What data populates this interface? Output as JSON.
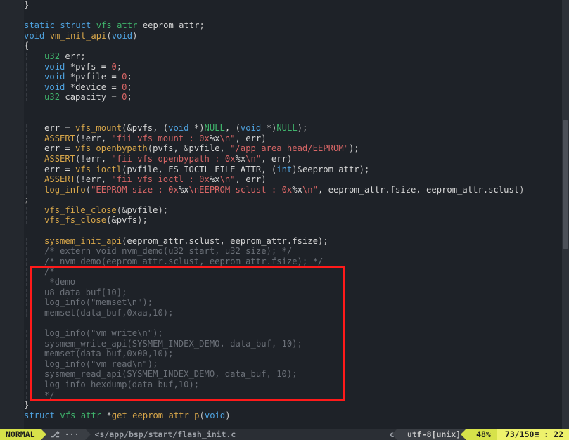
{
  "first_line_no": 95,
  "statusbar": {
    "mode": "NORMAL",
    "branch_icon": "⎇",
    "branch": "···",
    "path": "<s/app/bsp/start/flash_init.c",
    "filetype": "c",
    "encoding": "utf-8[unix]",
    "percent": "48%",
    "position": "73/150≡ : 22"
  },
  "redbox": {
    "top_line": 120,
    "bottom_line": 132,
    "left_col": 4,
    "right_col": 64
  },
  "scrollbar": {
    "top_pct": 28,
    "height_pct": 30
  },
  "lines": [
    {
      "no": 95,
      "indent": 0,
      "spans": [
        [
          "sym",
          "}"
        ]
      ]
    },
    {
      "no": 96,
      "indent": 0,
      "spans": []
    },
    {
      "no": 97,
      "indent": 0,
      "spans": [
        [
          "kw",
          "static"
        ],
        [
          "id",
          " "
        ],
        [
          "kw",
          "struct"
        ],
        [
          "id",
          " "
        ],
        [
          "type",
          "vfs_attr"
        ],
        [
          "id",
          " eeprom_attr"
        ],
        [
          "sym",
          ";"
        ]
      ]
    },
    {
      "no": 98,
      "indent": 0,
      "spans": [
        [
          "kw",
          "void"
        ],
        [
          "id",
          " "
        ],
        [
          "fn",
          "vm_init_api"
        ],
        [
          "sym",
          "("
        ],
        [
          "kw",
          "void"
        ],
        [
          "sym",
          ")"
        ]
      ]
    },
    {
      "no": 99,
      "indent": 0,
      "spans": [
        [
          "sym",
          "{"
        ]
      ]
    },
    {
      "no": 100,
      "indent": 1,
      "spans": [
        [
          "type",
          "u32"
        ],
        [
          "id",
          " err"
        ],
        [
          "sym",
          ";"
        ]
      ]
    },
    {
      "no": 101,
      "indent": 1,
      "spans": [
        [
          "kw",
          "void"
        ],
        [
          "id",
          " "
        ],
        [
          "sym",
          "*"
        ],
        [
          "id",
          "pvfs = "
        ],
        [
          "num",
          "0"
        ],
        [
          "sym",
          ";"
        ]
      ]
    },
    {
      "no": 102,
      "indent": 1,
      "spans": [
        [
          "kw",
          "void"
        ],
        [
          "id",
          " "
        ],
        [
          "sym",
          "*"
        ],
        [
          "id",
          "pvfile = "
        ],
        [
          "num",
          "0"
        ],
        [
          "sym",
          ";"
        ]
      ]
    },
    {
      "no": 103,
      "indent": 1,
      "spans": [
        [
          "kw",
          "void"
        ],
        [
          "id",
          " "
        ],
        [
          "sym",
          "*"
        ],
        [
          "id",
          "device = "
        ],
        [
          "num",
          "0"
        ],
        [
          "sym",
          ";"
        ]
      ]
    },
    {
      "no": 104,
      "indent": 1,
      "spans": [
        [
          "type",
          "u32"
        ],
        [
          "id",
          " capacity = "
        ],
        [
          "num",
          "0"
        ],
        [
          "sym",
          ";"
        ]
      ]
    },
    {
      "no": 105,
      "indent": 0,
      "spans": []
    },
    {
      "no": 106,
      "indent": 0,
      "spans": []
    },
    {
      "no": 107,
      "indent": 1,
      "spans": [
        [
          "id",
          "err = "
        ],
        [
          "fn",
          "vfs_mount"
        ],
        [
          "sym",
          "(&"
        ],
        [
          "id",
          "pvfs, ("
        ],
        [
          "kw",
          "void"
        ],
        [
          "id",
          " "
        ],
        [
          "sym",
          "*)"
        ],
        [
          "type",
          "NULL"
        ],
        [
          "id",
          ", ("
        ],
        [
          "kw",
          "void"
        ],
        [
          "id",
          " "
        ],
        [
          "sym",
          "*)"
        ],
        [
          "type",
          "NULL"
        ],
        [
          "sym",
          ");"
        ]
      ]
    },
    {
      "no": 108,
      "indent": 1,
      "spans": [
        [
          "fn",
          "ASSERT"
        ],
        [
          "sym",
          "(!"
        ],
        [
          "id",
          "err, "
        ],
        [
          "str",
          "\"fii vfs mount : 0x"
        ],
        [
          "id",
          "%x"
        ],
        [
          "str",
          "\\n\""
        ],
        [
          "id",
          ", err"
        ],
        [
          "sym",
          ")"
        ]
      ]
    },
    {
      "no": 109,
      "indent": 1,
      "spans": [
        [
          "id",
          "err = "
        ],
        [
          "fn",
          "vfs_openbypath"
        ],
        [
          "sym",
          "("
        ],
        [
          "id",
          "pvfs, "
        ],
        [
          "sym",
          "&"
        ],
        [
          "id",
          "pvfile, "
        ],
        [
          "str",
          "\"/app_area_head/EEPROM\""
        ],
        [
          "sym",
          ");"
        ]
      ]
    },
    {
      "no": 110,
      "indent": 1,
      "spans": [
        [
          "fn",
          "ASSERT"
        ],
        [
          "sym",
          "(!"
        ],
        [
          "id",
          "err, "
        ],
        [
          "str",
          "\"fii vfs openbypath : 0x"
        ],
        [
          "id",
          "%x"
        ],
        [
          "str",
          "\\n\""
        ],
        [
          "id",
          ", err"
        ],
        [
          "sym",
          ")"
        ]
      ]
    },
    {
      "no": 111,
      "indent": 1,
      "spans": [
        [
          "id",
          "err = "
        ],
        [
          "fn",
          "vfs_ioctl"
        ],
        [
          "sym",
          "("
        ],
        [
          "id",
          "pvfile, FS_IOCTL_FILE_ATTR, ("
        ],
        [
          "kw",
          "int"
        ],
        [
          "sym",
          ")&"
        ],
        [
          "id",
          "eeprom_attr"
        ],
        [
          "sym",
          ");"
        ]
      ]
    },
    {
      "no": 112,
      "indent": 1,
      "spans": [
        [
          "fn",
          "ASSERT"
        ],
        [
          "sym",
          "(!"
        ],
        [
          "id",
          "err, "
        ],
        [
          "str",
          "\"fii vfs ioctl : 0x"
        ],
        [
          "id",
          "%x"
        ],
        [
          "str",
          "\\n\""
        ],
        [
          "id",
          ", err"
        ],
        [
          "sym",
          ")"
        ]
      ]
    },
    {
      "no": 113,
      "indent": 1,
      "spans": [
        [
          "fn",
          "log_info"
        ],
        [
          "sym",
          "("
        ],
        [
          "str",
          "\"EEPROM size : 0x"
        ],
        [
          "id",
          "%x"
        ],
        [
          "str",
          "\\nEEPROM sclust : 0x"
        ],
        [
          "id",
          "%x"
        ],
        [
          "str",
          "\\n\""
        ],
        [
          "id",
          ", eeprom_attr.fsize, eeprom_attr.sclust"
        ],
        [
          "sym",
          ")"
        ]
      ],
      "tail": true
    },
    {
      "no": 114,
      "indent": 1,
      "spans": [
        [
          "fn",
          "vfs_file_close"
        ],
        [
          "sym",
          "(&"
        ],
        [
          "id",
          "pvfile"
        ],
        [
          "sym",
          ");"
        ]
      ]
    },
    {
      "no": 115,
      "indent": 1,
      "spans": [
        [
          "fn",
          "vfs_fs_close"
        ],
        [
          "sym",
          "(&"
        ],
        [
          "id",
          "pvfs"
        ],
        [
          "sym",
          ");"
        ]
      ]
    },
    {
      "no": 116,
      "indent": 0,
      "spans": []
    },
    {
      "no": 117,
      "indent": 1,
      "spans": [
        [
          "fn",
          "sysmem_init_api"
        ],
        [
          "sym",
          "("
        ],
        [
          "id",
          "eeprom_attr.sclust, eeprom_attr.fsize"
        ],
        [
          "sym",
          ");"
        ]
      ]
    },
    {
      "no": 118,
      "indent": 1,
      "spans": [
        [
          "cmt",
          "/* extern void nvm_demo(u32 start, u32 size); */"
        ]
      ]
    },
    {
      "no": 119,
      "indent": 1,
      "spans": [
        [
          "cmt",
          "/* nvm_demo(eeprom_attr.sclust, eeprom_attr.fsize); */"
        ]
      ]
    },
    {
      "no": 120,
      "indent": 1,
      "spans": [
        [
          "cmt",
          "/*"
        ]
      ]
    },
    {
      "no": 121,
      "indent": 1,
      "spans": [
        [
          "cmt",
          " *demo"
        ]
      ]
    },
    {
      "no": 122,
      "indent": 1,
      "spans": [
        [
          "cmt",
          "u8 data_buf[10];"
        ]
      ]
    },
    {
      "no": 123,
      "indent": 1,
      "spans": [
        [
          "cmt",
          "log_info(\"memset\\n\");"
        ]
      ]
    },
    {
      "no": 124,
      "indent": 1,
      "spans": [
        [
          "cmt",
          "memset(data_buf,0xaa,10);"
        ]
      ]
    },
    {
      "no": 125,
      "indent": 0,
      "spans": []
    },
    {
      "no": 126,
      "indent": 1,
      "spans": [
        [
          "cmt",
          "log_info(\"vm write\\n\");"
        ]
      ]
    },
    {
      "no": 127,
      "indent": 1,
      "spans": [
        [
          "cmt",
          "sysmem_write_api(SYSMEM_INDEX_DEMO, data_buf, 10);"
        ]
      ]
    },
    {
      "no": 128,
      "indent": 1,
      "spans": [
        [
          "cmt",
          "memset(data_buf,0x00,10);"
        ]
      ]
    },
    {
      "no": 129,
      "indent": 1,
      "spans": [
        [
          "cmt",
          "log_info(\"vm read\\n\");"
        ]
      ]
    },
    {
      "no": 130,
      "indent": 1,
      "spans": [
        [
          "cmt",
          "sysmem_read_api(SYSMEM_INDEX_DEMO, data_buf, 10);"
        ]
      ]
    },
    {
      "no": 131,
      "indent": 1,
      "spans": [
        [
          "cmt",
          "log_info_hexdump(data_buf,10);"
        ]
      ]
    },
    {
      "no": 132,
      "indent": 1,
      "spans": [
        [
          "cmt",
          "*/"
        ]
      ]
    },
    {
      "no": 133,
      "indent": 0,
      "spans": [
        [
          "sym",
          "}"
        ]
      ]
    },
    {
      "no": 134,
      "indent": 0,
      "dim": true,
      "spans": [
        [
          "kw",
          "struct"
        ],
        [
          "id",
          " "
        ],
        [
          "type",
          "vfs_attr"
        ],
        [
          "id",
          " "
        ],
        [
          "sym",
          "*"
        ],
        [
          "fn",
          "get_eeprom_attr_p"
        ],
        [
          "sym",
          "("
        ],
        [
          "kw",
          "void"
        ],
        [
          "sym",
          ")"
        ]
      ]
    }
  ]
}
